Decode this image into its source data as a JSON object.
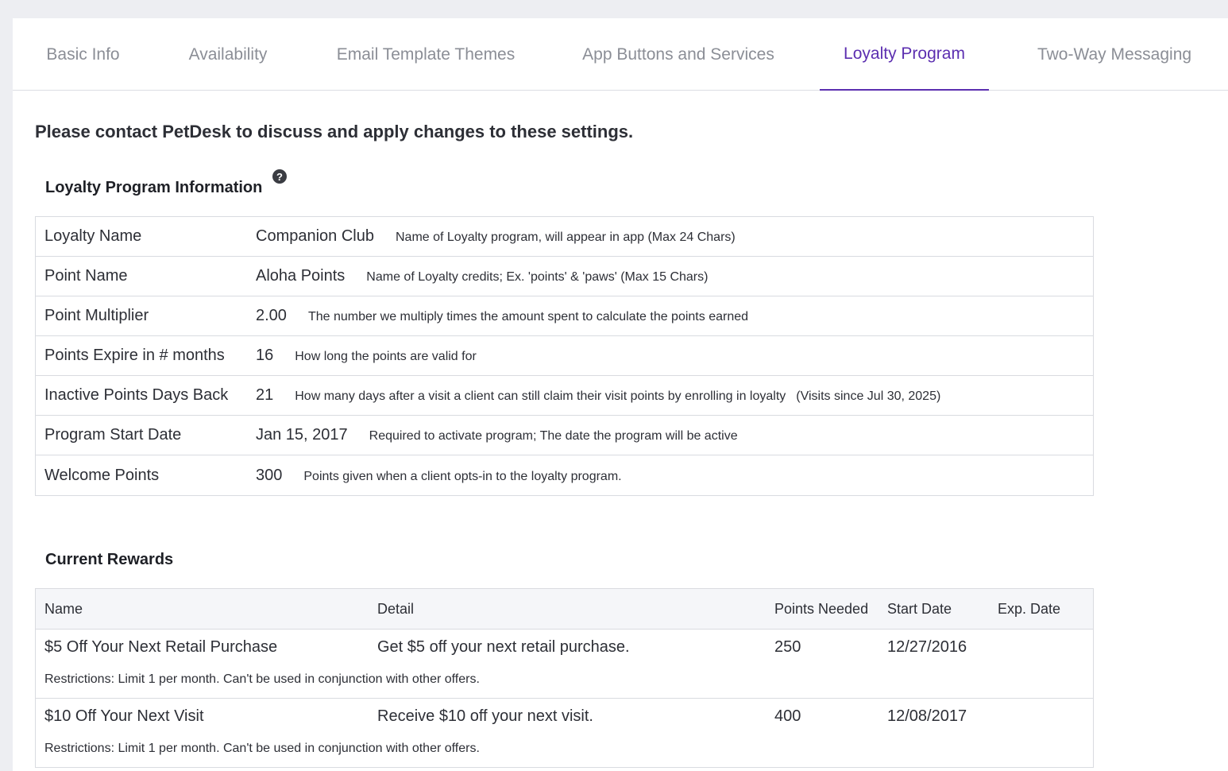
{
  "tabs": [
    {
      "label": "Basic Info",
      "active": false
    },
    {
      "label": "Availability",
      "active": false
    },
    {
      "label": "Email Template Themes",
      "active": false
    },
    {
      "label": "App Buttons and Services",
      "active": false
    },
    {
      "label": "Loyalty Program",
      "active": true
    },
    {
      "label": "Two-Way Messaging",
      "active": false
    }
  ],
  "notice": "Please contact PetDesk to discuss and apply changes to these settings.",
  "info_section": {
    "title": "Loyalty Program Information",
    "help_icon": "question-circle-icon",
    "help_glyph": "?",
    "rows": [
      {
        "label": "Loyalty Name",
        "value": "Companion Club",
        "hint": "Name of Loyalty program, will appear in app (Max 24 Chars)",
        "extra": ""
      },
      {
        "label": "Point Name",
        "value": "Aloha Points",
        "hint": "Name of Loyalty credits; Ex. 'points' & 'paws' (Max 15 Chars)",
        "extra": ""
      },
      {
        "label": "Point Multiplier",
        "value": "2.00",
        "hint": "The number we multiply times the amount spent to calculate the points earned",
        "extra": ""
      },
      {
        "label": "Points Expire in # months",
        "value": "16",
        "hint": "How long the points are valid for",
        "extra": ""
      },
      {
        "label": "Inactive Points Days Back",
        "value": "21",
        "hint": "How many days after a visit a client can still claim their visit points by enrolling in loyalty",
        "extra": "(Visits since Jul 30, 2025)"
      },
      {
        "label": "Program Start Date",
        "value": "Jan 15, 2017",
        "hint": "Required to activate program; The date the program will be active",
        "extra": ""
      },
      {
        "label": "Welcome Points",
        "value": "300",
        "hint": "Points given when a client opts-in to the loyalty program.",
        "extra": ""
      }
    ]
  },
  "rewards_section": {
    "title": "Current Rewards",
    "columns": {
      "name": "Name",
      "detail": "Detail",
      "points": "Points Needed",
      "start": "Start Date",
      "exp": "Exp. Date"
    },
    "rows": [
      {
        "name": "$5 Off Your Next Retail Purchase",
        "detail": "Get $5 off your next retail purchase.",
        "points": "250",
        "start": "12/27/2016",
        "exp": "",
        "restrictions": "Restrictions:  Limit 1 per month. Can't be used in conjunction with other offers."
      },
      {
        "name": "$10 Off Your Next Visit",
        "detail": "Receive $10 off your next visit.",
        "points": "400",
        "start": "12/08/2017",
        "exp": "",
        "restrictions": "Restrictions:  Limit 1 per month. Can't be used in conjunction with other offers."
      }
    ]
  },
  "colors": {
    "accent": "#5c2fb0",
    "tab_inactive": "#8b8e96",
    "background": "#edeef2",
    "border": "#d9dbe0"
  }
}
